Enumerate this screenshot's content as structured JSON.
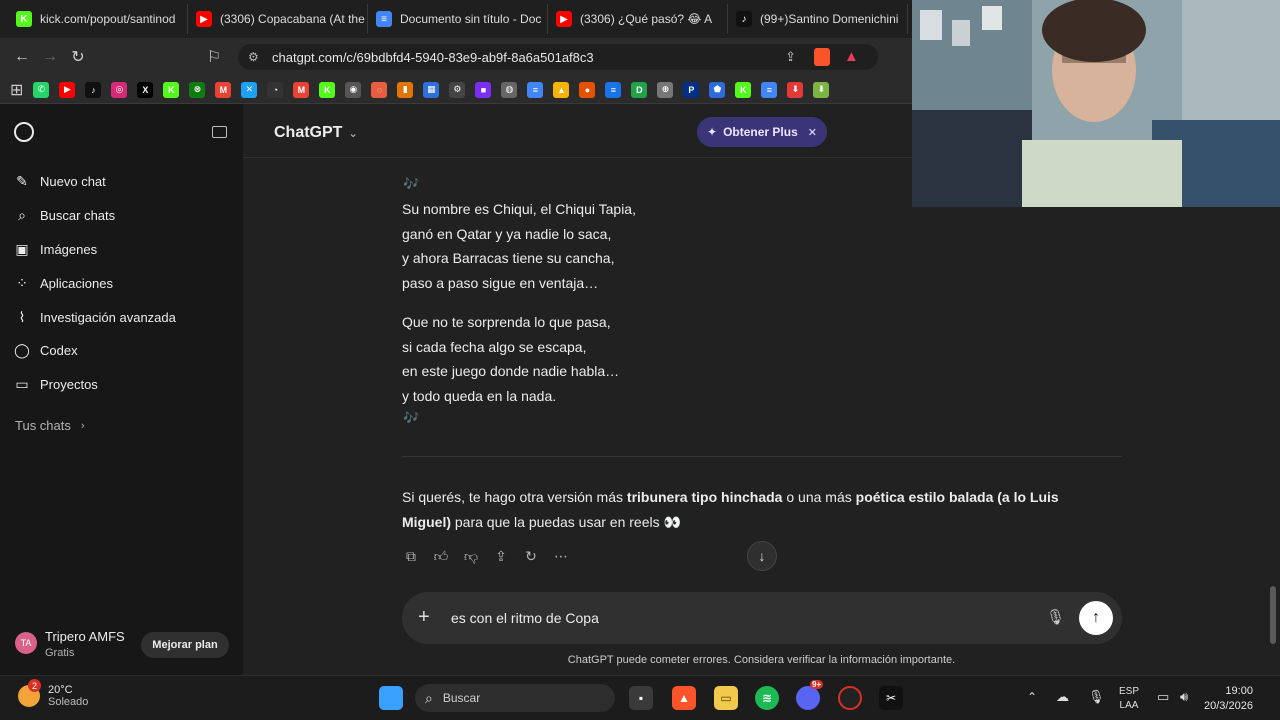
{
  "browser": {
    "tabs": [
      {
        "label": "kick.com/popout/santinod",
        "icon": "kick-icon",
        "color": "#53fc18",
        "glyph": "K"
      },
      {
        "label": "(3306) Copacabana (At the",
        "icon": "youtube-icon",
        "color": "#ff0000",
        "glyph": "▶"
      },
      {
        "label": "Documento sin título - Doc",
        "icon": "docs-icon",
        "color": "#4285f4",
        "glyph": "≡"
      },
      {
        "label": "(3306) ¿Qué pasó? 😂 A",
        "icon": "youtube-icon",
        "color": "#ff0000",
        "glyph": "▶"
      },
      {
        "label": "(99+)Santino Domenichini",
        "icon": "tiktok-icon",
        "color": "#111111",
        "glyph": "♪"
      }
    ],
    "url": "chatgpt.com/c/69bdbfd4-5940-83e9-ab9f-8a6a501af8c3"
  },
  "bookmarks": [
    {
      "icon": "whatsapp-icon",
      "color": "#25d366",
      "glyph": "✆"
    },
    {
      "icon": "youtube-icon",
      "color": "#ff0000",
      "glyph": "▶"
    },
    {
      "icon": "tiktok-icon",
      "color": "#111111",
      "glyph": "♪"
    },
    {
      "icon": "instagram-icon",
      "color": "#d62976",
      "glyph": "◎"
    },
    {
      "icon": "x-icon",
      "color": "#000000",
      "glyph": "X"
    },
    {
      "icon": "kick-icon",
      "color": "#53fc18",
      "glyph": "K"
    },
    {
      "icon": "xbox-icon",
      "color": "#107c10",
      "glyph": "⊗"
    },
    {
      "icon": "gmail-icon",
      "color": "#ea4335",
      "glyph": "M"
    },
    {
      "icon": "bookmark-app-icon",
      "color": "#1da1f2",
      "glyph": "✕"
    },
    {
      "icon": "bookmark-app-icon",
      "color": "#333333",
      "glyph": "◔"
    },
    {
      "icon": "gmail-icon",
      "color": "#ea4335",
      "glyph": "M"
    },
    {
      "icon": "kick-icon",
      "color": "#53fc18",
      "glyph": "K"
    },
    {
      "icon": "bookmark-app-icon",
      "color": "#555555",
      "glyph": "◉"
    },
    {
      "icon": "bookmark-app-icon",
      "color": "#e85d3f",
      "glyph": "◌"
    },
    {
      "icon": "analytics-icon",
      "color": "#e37400",
      "glyph": "▮"
    },
    {
      "icon": "bookmark-app-icon",
      "color": "#2f6fdb",
      "glyph": "▦"
    },
    {
      "icon": "bookmark-app-icon",
      "color": "#444444",
      "glyph": "⚙"
    },
    {
      "icon": "bookmark-app-icon",
      "color": "#7b2cf5",
      "glyph": "■"
    },
    {
      "icon": "bookmark-app-icon",
      "color": "#666666",
      "glyph": "◍"
    },
    {
      "icon": "docs-icon",
      "color": "#4285f4",
      "glyph": "≡"
    },
    {
      "icon": "drive-icon",
      "color": "#f4b400",
      "glyph": "▲"
    },
    {
      "icon": "bookmark-app-icon",
      "color": "#e65100",
      "glyph": "●"
    },
    {
      "icon": "bookmark-app-icon",
      "color": "#1a73e8",
      "glyph": "≡"
    },
    {
      "icon": "bookmark-app-icon",
      "color": "#22a34a",
      "glyph": "D"
    },
    {
      "icon": "bookmark-app-icon",
      "color": "#777777",
      "glyph": "⊕"
    },
    {
      "icon": "paypal-icon",
      "color": "#003087",
      "glyph": "P"
    },
    {
      "icon": "bookmark-app-icon",
      "color": "#2d6cdf",
      "glyph": "⬟"
    },
    {
      "icon": "kick-icon",
      "color": "#53fc18",
      "glyph": "K"
    },
    {
      "icon": "docs-icon",
      "color": "#4285f4",
      "glyph": "≡"
    },
    {
      "icon": "bookmark-app-icon",
      "color": "#e53935",
      "glyph": "⬇"
    },
    {
      "icon": "bookmark-app-icon",
      "color": "#7cb342",
      "glyph": "⬇"
    }
  ],
  "sidebar": {
    "items": [
      {
        "label": "Nuevo chat",
        "icon": "edit-icon",
        "glyph": "✎"
      },
      {
        "label": "Buscar chats",
        "icon": "search-icon",
        "glyph": "⌕"
      },
      {
        "label": "Imágenes",
        "icon": "image-icon",
        "glyph": "▣"
      },
      {
        "label": "Aplicaciones",
        "icon": "apps-icon",
        "glyph": "⁘"
      },
      {
        "label": "Investigación avanzada",
        "icon": "research-icon",
        "glyph": "⌇"
      },
      {
        "label": "Codex",
        "icon": "codex-icon",
        "glyph": "◯"
      },
      {
        "label": "Proyectos",
        "icon": "folder-icon",
        "glyph": "▭"
      }
    ],
    "chats_label": "Tus chats",
    "user": {
      "initials": "TA",
      "name": "Tripero AMFS",
      "plan": "Gratis",
      "upgrade": "Mejorar plan"
    }
  },
  "header": {
    "title": "ChatGPT",
    "promo": "Obtener Plus"
  },
  "message": {
    "stanza1": [
      "Su nombre es Chiqui, el Chiqui Tapia,",
      "ganó en Qatar y ya nadie lo saca,",
      "y ahora Barracas tiene su cancha,",
      "paso a paso sigue en ventaja…"
    ],
    "stanza2": [
      "Que no te sorprenda lo que pasa,",
      "si cada fecha algo se escapa,",
      "en este juego donde nadie habla…",
      "y todo queda en la nada."
    ],
    "note_glyph": "🎶",
    "followup": {
      "p1": "Si querés, te hago otra versión más ",
      "b1": "tribunera tipo hinchada",
      "p2": " o una más ",
      "b2": "poética estilo balada (a lo Luis Miguel)",
      "p3": " para que la puedas usar en reels 👀"
    }
  },
  "composer": {
    "value": "es con el ritmo de Copa",
    "disclaimer": "ChatGPT puede cometer errores. Considera verificar la información importante."
  },
  "taskbar": {
    "weather_temp": "20°C",
    "weather_desc": "Soleado",
    "weather_badge": "2",
    "search_label": "Buscar",
    "lang1": "ESP",
    "lang2": "LAA",
    "time": "19:00",
    "date": "20/3/2026",
    "discord_badge": "9+"
  },
  "colors": {
    "accent_promo": "#3b3578",
    "promo_text": "#e8e6ff",
    "send_button": "#ffffff"
  }
}
